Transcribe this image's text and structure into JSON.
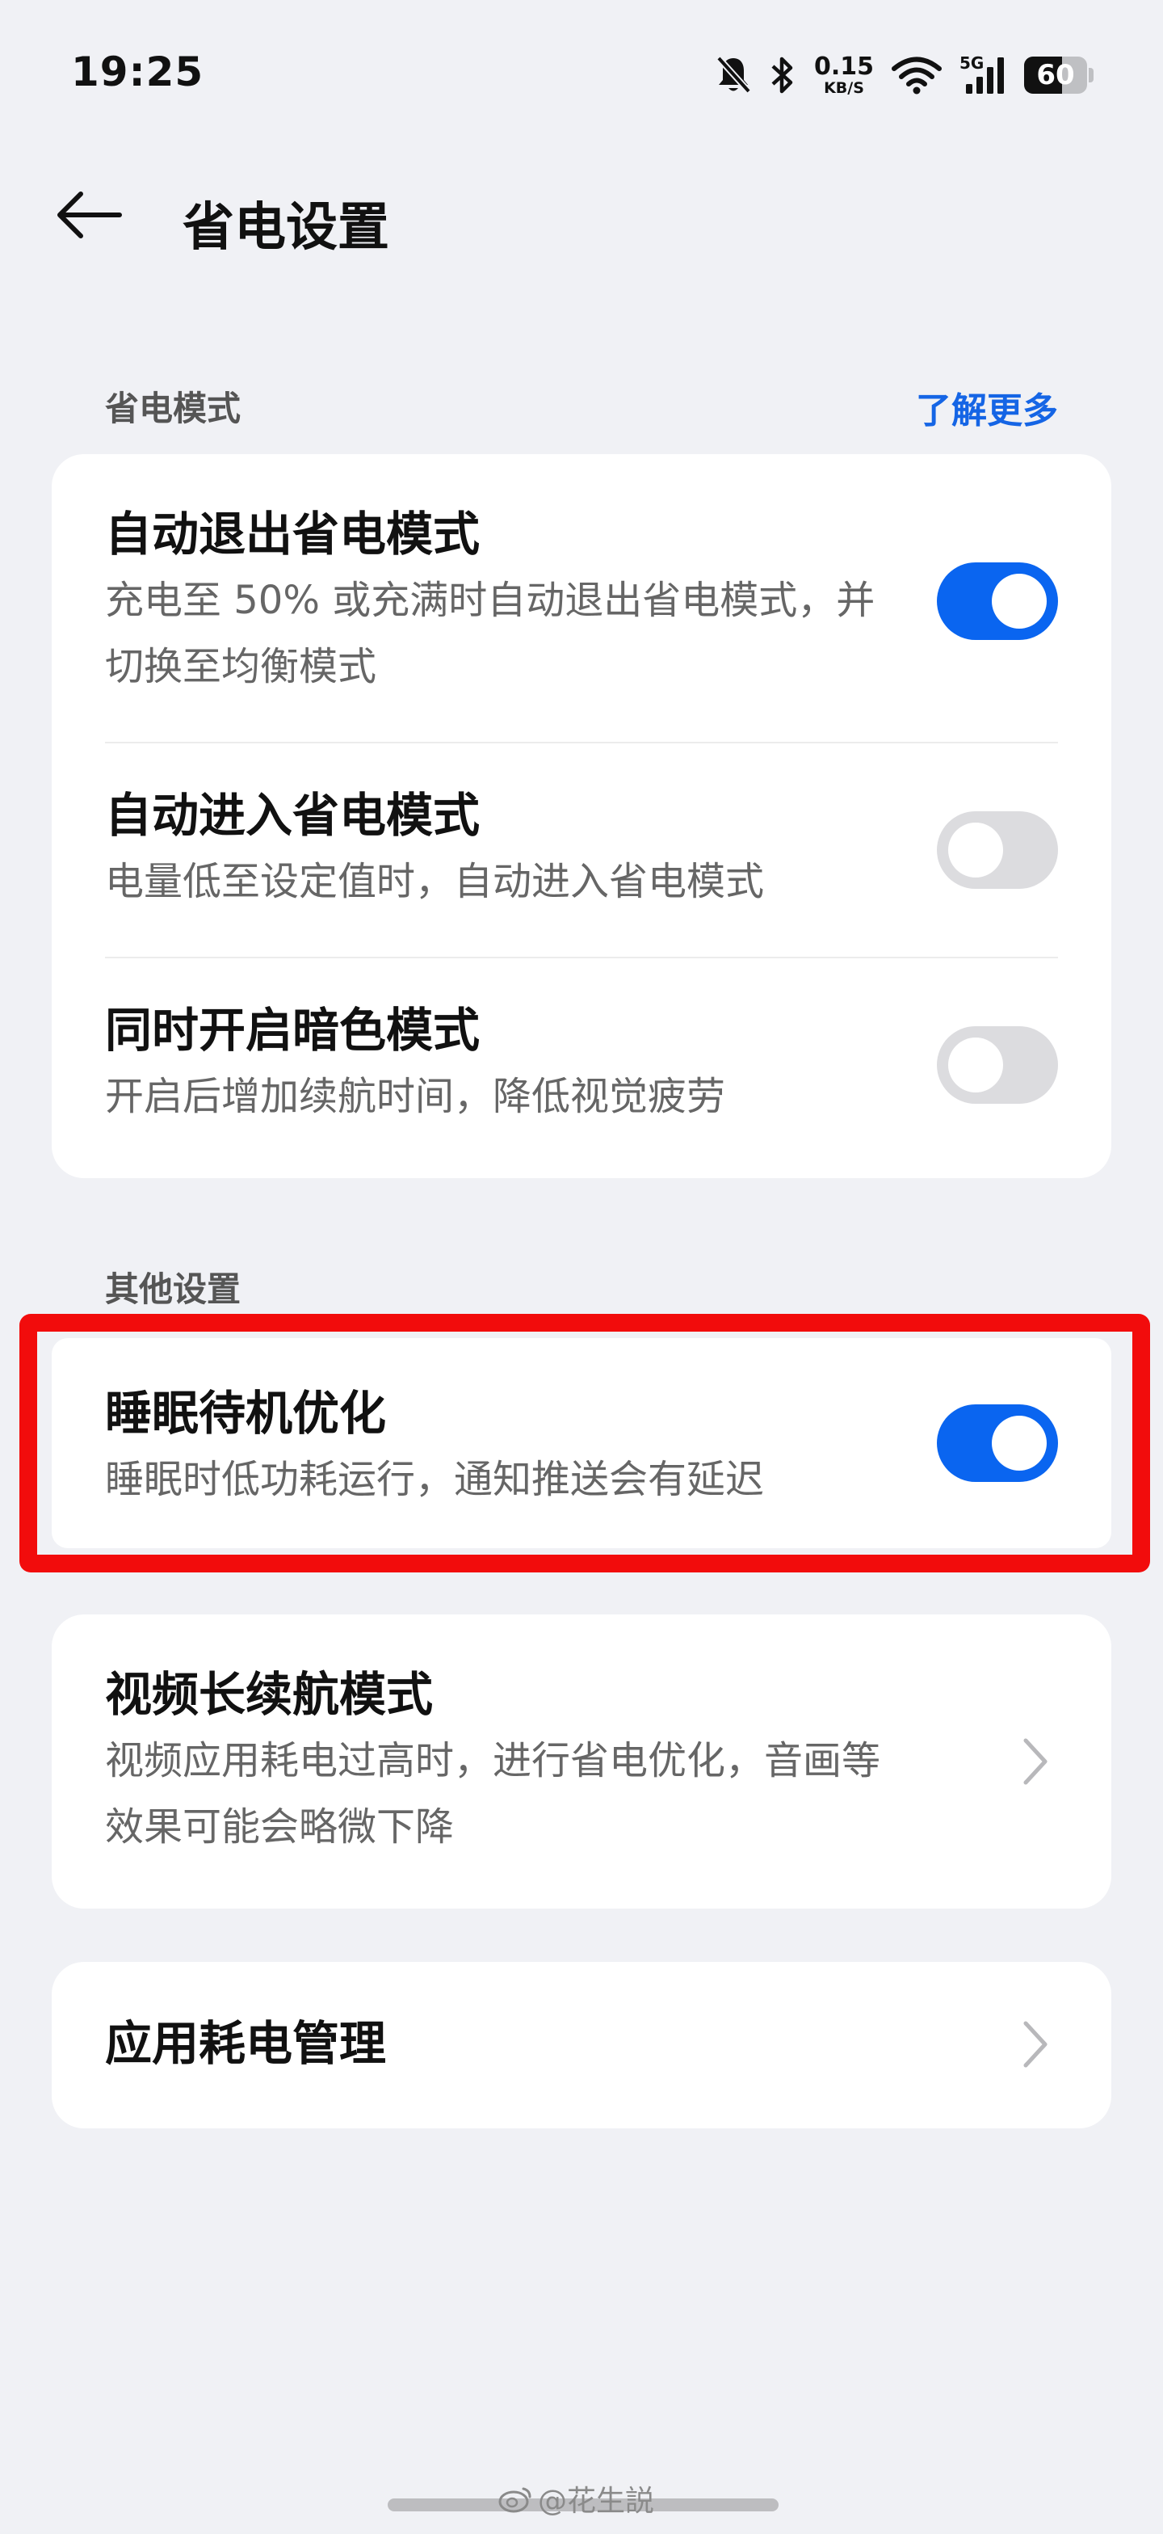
{
  "status_bar": {
    "time": "19:25",
    "net_speed_value": "0.15",
    "net_speed_unit": "KB/S",
    "network_type": "5G",
    "battery": "60",
    "battery_level": 0.6,
    "icons": [
      "mute-bell-icon",
      "bluetooth-icon",
      "wifi-icon",
      "cellular-signal-icon",
      "battery-icon"
    ]
  },
  "header": {
    "back_icon": "arrow-left-icon",
    "title": "省电设置"
  },
  "power_saving_section": {
    "label": "省电模式",
    "learn_more": "了解更多",
    "items": [
      {
        "title": "自动退出省电模式",
        "subtitle": "充电至 50% 或充满时自动退出省电模式，并切换至均衡模式",
        "enabled": true
      },
      {
        "title": "自动进入省电模式",
        "subtitle": "电量低至设定值时，自动进入省电模式",
        "enabled": false
      },
      {
        "title": "同时开启暗色模式",
        "subtitle": "开启后增加续航时间，降低视觉疲劳",
        "enabled": false
      }
    ]
  },
  "other_section": {
    "label": "其他设置",
    "items": [
      {
        "title": "睡眠待机优化",
        "subtitle": "睡眠时低功耗运行，通知推送会有延迟",
        "enabled": true
      }
    ]
  },
  "video_card": {
    "title": "视频长续航模式",
    "subtitle": "视频应用耗电过高时，进行省电优化，音画等效果可能会略微下降"
  },
  "app_power_card": {
    "title": "应用耗电管理"
  },
  "annotation_color": "#f20c0c",
  "accent_color": "#0a65f0",
  "watermark": "@花生説"
}
